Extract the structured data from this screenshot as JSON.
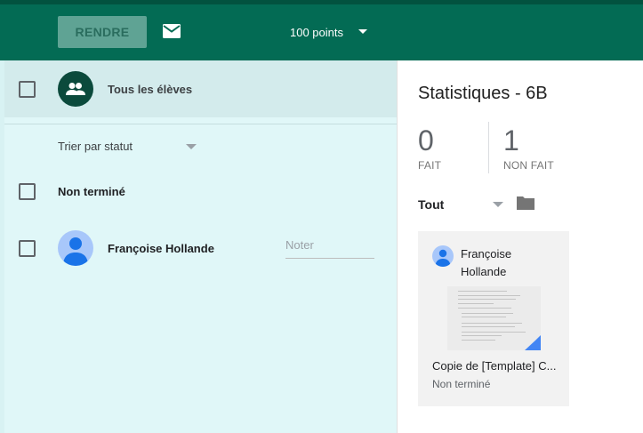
{
  "header": {
    "return_label": "RENDRE",
    "mail_icon": "mail-icon",
    "points_value": "100 points"
  },
  "students_panel": {
    "all_students_label": "Tous les élèves",
    "sort_label": "Trier par statut",
    "group_label": "Non terminé",
    "students": [
      {
        "name": "Françoise Hollande",
        "grade_placeholder": "Noter"
      }
    ]
  },
  "stats_panel": {
    "title": "Statistiques - 6B",
    "done_count": "0",
    "done_label": "FAIT",
    "not_done_count": "1",
    "not_done_label": "NON FAIT",
    "filter_label": "Tout",
    "folder_icon": "folder-icon"
  },
  "submission_card": {
    "student_name": "Françoise Hollande",
    "file_name": "Copie de [Template] C...",
    "status": "Non terminé"
  },
  "colors": {
    "header_bg": "#036b54",
    "left_panel_bg": "#e0f7f8",
    "avatar_bg": "#a8c7fa",
    "group_avatar_bg": "#0b4a3c"
  }
}
